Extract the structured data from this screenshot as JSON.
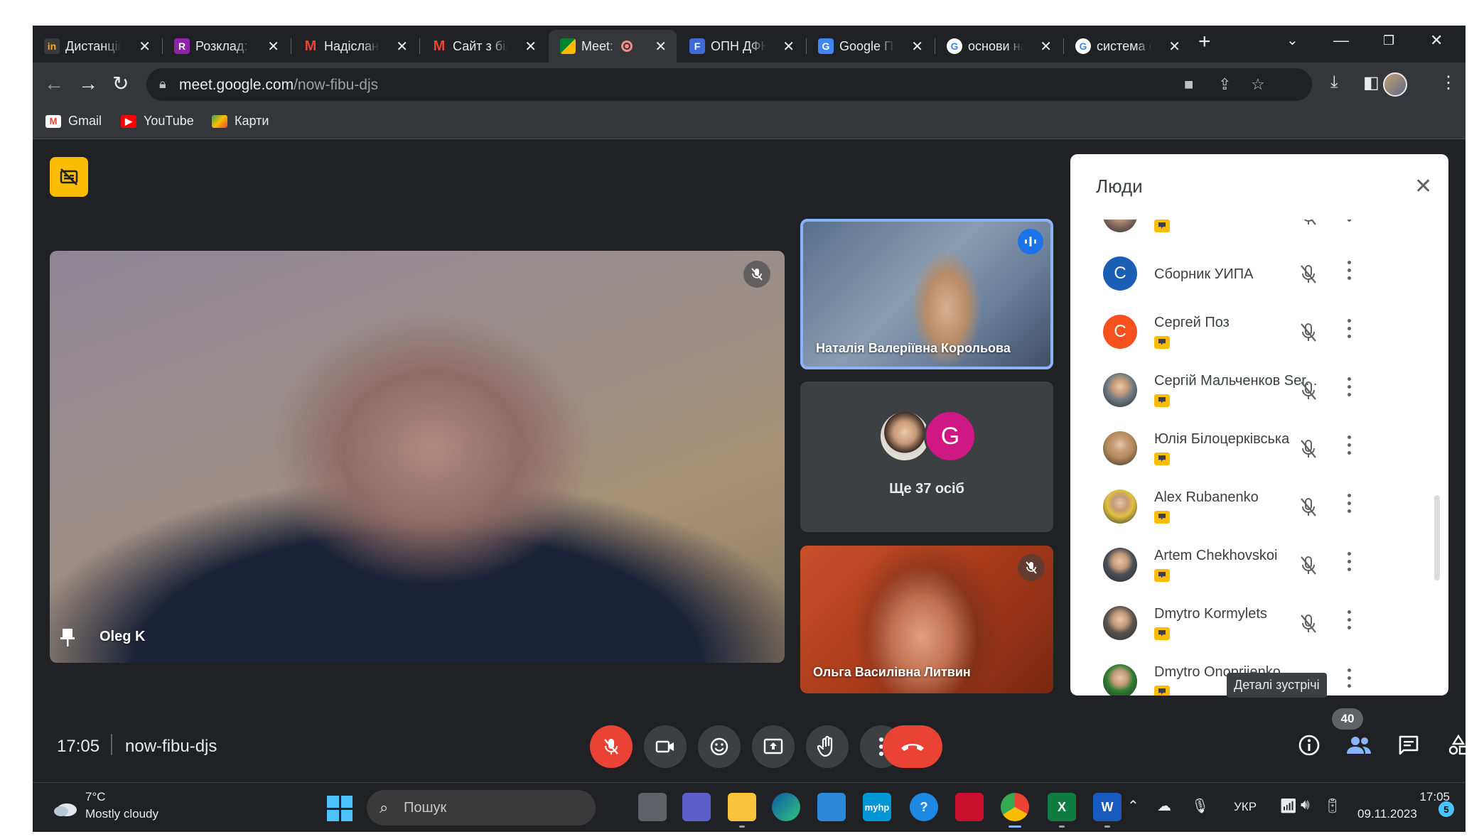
{
  "browser": {
    "tabs": [
      {
        "title": "Дистанційн",
        "icon": "in"
      },
      {
        "title": "Розклад: Ф",
        "icon": "R"
      },
      {
        "title": "Надіслані -",
        "icon": "M"
      },
      {
        "title": "Сайт з біл",
        "icon": "M"
      },
      {
        "title": "Meet: ",
        "icon": "meet",
        "active": true,
        "recording": true
      },
      {
        "title": "ОПН ДФН",
        "icon": "F"
      },
      {
        "title": "Google Пре",
        "icon": "G"
      },
      {
        "title": "основи на",
        "icon": "G"
      },
      {
        "title": "система с",
        "icon": "G"
      }
    ],
    "new_tab": "+",
    "close_glyph": "✕",
    "url_host": "meet.google.com",
    "url_path": "/now-fibu-djs",
    "bookmarks": [
      {
        "label": "Gmail",
        "color": "#ea4335"
      },
      {
        "label": "YouTube",
        "color": "#ff0000"
      },
      {
        "label": "Карти",
        "color": "#34a853"
      }
    ]
  },
  "meet": {
    "main_participant": "Oleg K",
    "side_tiles": [
      {
        "name": "Наталія Валеріївна Корольова",
        "speaking": true
      },
      {
        "more_label": "Ще 37 осіб",
        "avatar_letter": "G"
      },
      {
        "name": "Ольга Василівна Литвин",
        "muted": true
      }
    ],
    "people_panel": {
      "title": "Люди",
      "participants": [
        {
          "name": "",
          "avatar": "photo",
          "color": "#8d6e63"
        },
        {
          "name": "Сборник УИПА",
          "avatar": "С",
          "color": "#1a5fb4"
        },
        {
          "name": "Сергей Поз",
          "avatar": "С",
          "color": "#f4511e"
        },
        {
          "name": "Сергій Мальченков Ser...",
          "avatar": "photo",
          "color": "#6d7a82"
        },
        {
          "name": "Юлія Білоцерківська",
          "avatar": "photo",
          "color": "#b38a5a"
        },
        {
          "name": "Alex Rubanenko",
          "avatar": "photo",
          "color": "#e0c040"
        },
        {
          "name": "Artem Chekhovskoi",
          "avatar": "photo",
          "color": "#4a4f55"
        },
        {
          "name": "Dmytro Kormylets",
          "avatar": "photo",
          "color": "#5a5550"
        },
        {
          "name": "Dmytro Onoprijenko",
          "avatar": "photo",
          "color": "#2e7d32"
        }
      ]
    },
    "tooltip": "Деталі зустрічі",
    "participant_count": "40",
    "time": "17:05",
    "meeting_code": "now-fibu-djs"
  },
  "taskbar": {
    "weather_temp": "7°C",
    "weather_desc": "Mostly cloudy",
    "search_placeholder": "Пошук",
    "language": "УКР",
    "time": "17:05",
    "date": "09.11.2023",
    "notification_count": "5",
    "apps": [
      {
        "name": "task-view",
        "color": "#5f6368",
        "label": ""
      },
      {
        "name": "teams",
        "color": "#5b5fc7",
        "label": ""
      },
      {
        "name": "file-explorer",
        "color": "#f9c33c",
        "label": ""
      },
      {
        "name": "edge",
        "color": "#1b9de2",
        "label": ""
      },
      {
        "name": "store",
        "color": "#2b88d8",
        "label": ""
      },
      {
        "name": "myhp",
        "color": "#0096d6",
        "label": "myhp"
      },
      {
        "name": "help",
        "color": "#1e88e5",
        "label": "?"
      },
      {
        "name": "mcafee",
        "color": "#c8102e",
        "label": ""
      },
      {
        "name": "chrome",
        "color": "#4285f4",
        "label": ""
      },
      {
        "name": "excel",
        "color": "#107c41",
        "label": "X"
      },
      {
        "name": "word",
        "color": "#185abd",
        "label": "W"
      }
    ]
  }
}
